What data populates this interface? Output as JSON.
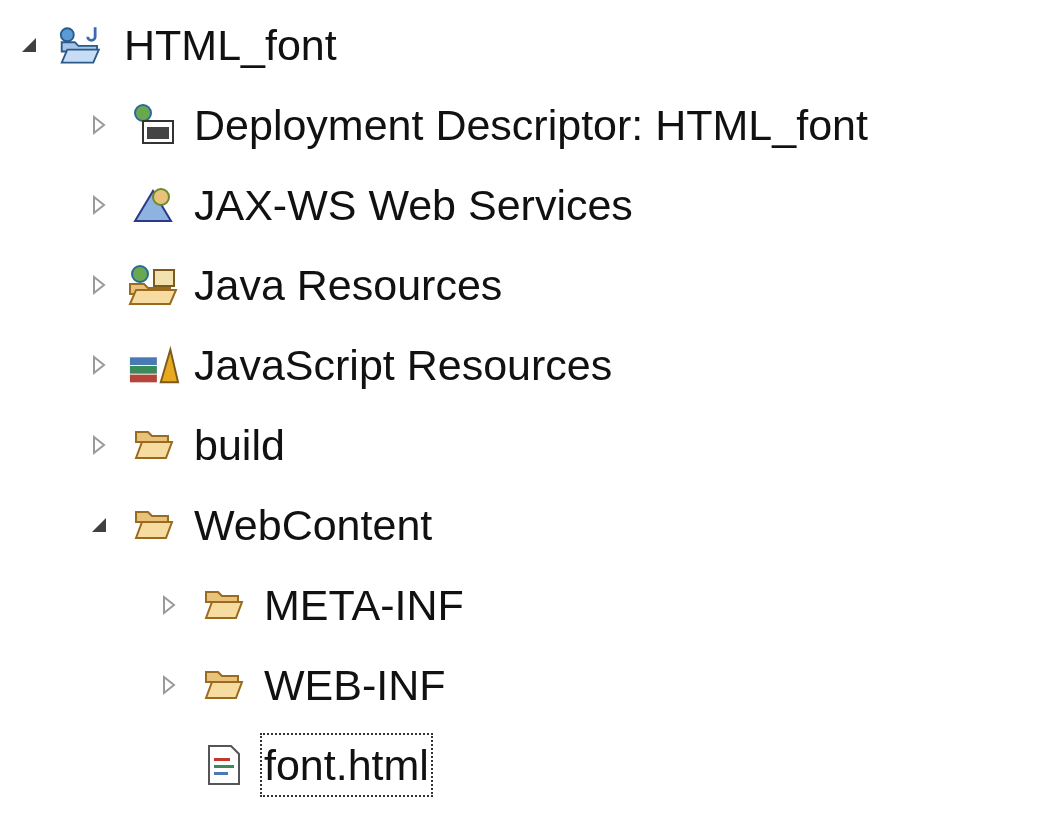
{
  "tree": [
    {
      "label": "HTML_font",
      "kind": "project",
      "expanded": true,
      "focused": false,
      "children": [
        {
          "label": "Deployment Descriptor: HTML_font",
          "kind": "descriptor",
          "expanded": false,
          "focused": false
        },
        {
          "label": "JAX-WS Web Services",
          "kind": "webservices",
          "expanded": false,
          "focused": false
        },
        {
          "label": "Java Resources",
          "kind": "javaresources",
          "expanded": false,
          "focused": false
        },
        {
          "label": "JavaScript Resources",
          "kind": "jsresources",
          "expanded": false,
          "focused": false
        },
        {
          "label": "build",
          "kind": "folder",
          "expanded": false,
          "focused": false
        },
        {
          "label": "WebContent",
          "kind": "folder",
          "expanded": true,
          "focused": false,
          "children": [
            {
              "label": "META-INF",
              "kind": "folder",
              "expanded": false,
              "focused": false
            },
            {
              "label": "WEB-INF",
              "kind": "folder",
              "expanded": false,
              "focused": false
            },
            {
              "label": "font.html",
              "kind": "htmlfile",
              "focused": true
            }
          ]
        }
      ]
    }
  ]
}
